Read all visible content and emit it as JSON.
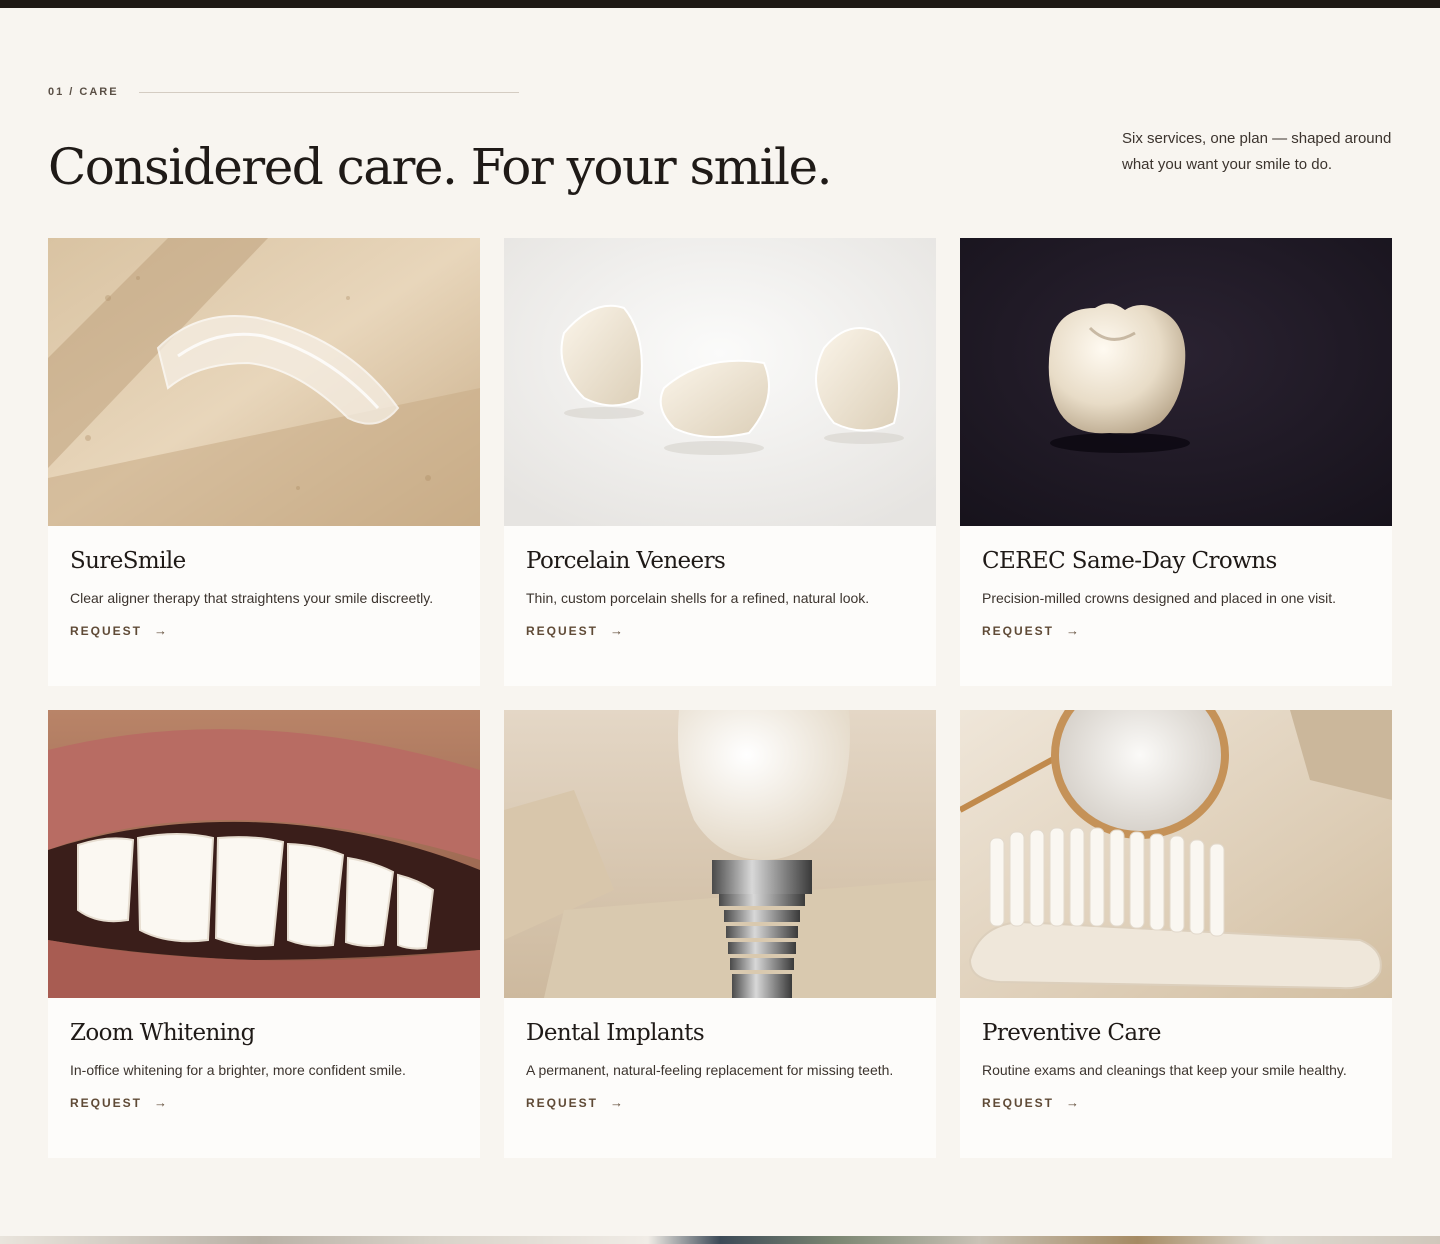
{
  "section": {
    "eyebrow": "01 / CARE",
    "headline": "Considered care. For your smile.",
    "intro": "Six services, one plan — shaped around what you want your smile to do."
  },
  "cards": [
    {
      "title": "SureSmile",
      "description": "Clear aligner therapy that straightens your smile discreetly.",
      "cta": "REQUEST",
      "arrow": "→",
      "icon": "aligner-image"
    },
    {
      "title": "Porcelain Veneers",
      "description": "Thin, custom porcelain shells for a refined, natural look.",
      "cta": "REQUEST",
      "arrow": "→",
      "icon": "veneers-image"
    },
    {
      "title": "CEREC Same-Day Crowns",
      "description": "Precision-milled crowns designed and placed in one visit.",
      "cta": "REQUEST",
      "arrow": "→",
      "icon": "crown-image"
    },
    {
      "title": "Zoom Whitening",
      "description": "In-office whitening for a brighter, more confident smile.",
      "cta": "REQUEST",
      "arrow": "→",
      "icon": "smile-image"
    },
    {
      "title": "Dental Implants",
      "description": "A permanent, natural-feeling replacement for missing teeth.",
      "cta": "REQUEST",
      "arrow": "→",
      "icon": "implant-image"
    },
    {
      "title": "Preventive Care",
      "description": "Routine exams and cleanings that keep your smile healthy.",
      "cta": "REQUEST",
      "arrow": "→",
      "icon": "toothbrush-mirror-image"
    }
  ],
  "colors": {
    "background": "#f8f5f0",
    "card": "#fdfcfa",
    "accent": "#5f4a36",
    "heading": "#1f1a17"
  }
}
